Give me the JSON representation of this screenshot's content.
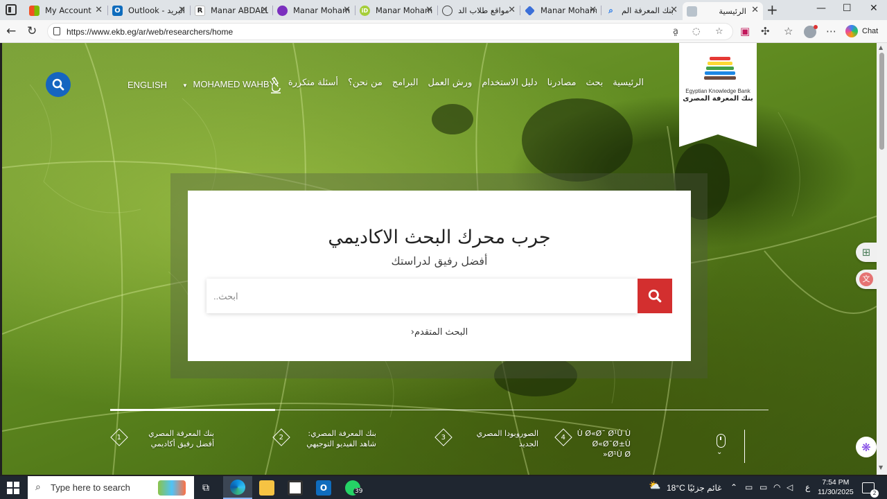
{
  "browser": {
    "tabs": [
      {
        "title": "My Account",
        "icon": "microsoft-icon",
        "color": "#f25022"
      },
      {
        "title": "Outlook - البريد",
        "icon": "outlook-icon",
        "color": "#0f6cbd"
      },
      {
        "title": "Manar ABDALL",
        "icon": "researchgate-icon",
        "color": "#444444"
      },
      {
        "title": "Manar Moham",
        "icon": "mendeley-icon",
        "color": "#7b2fbe"
      },
      {
        "title": "Manar Moham",
        "icon": "orcid-icon",
        "color": "#a6ce39"
      },
      {
        "title": "مواقع طلاب الد",
        "icon": "globe-icon",
        "color": "#555555"
      },
      {
        "title": "Manar Moham",
        "icon": "diamond-icon",
        "color": "#3b6fd8"
      },
      {
        "title": "بنك المعرفة الم",
        "icon": "search-icon",
        "color": "#1a73e8"
      },
      {
        "title": "الرئيسية",
        "icon": "ekb-icon",
        "color": "#6d7b88"
      }
    ],
    "url": "https://www.ekb.eg/ar/web/researchers/home",
    "chat_label": "Chat"
  },
  "site": {
    "logo_en": "Egyptian Knowledge Bank",
    "logo_ar": "بنك المعرفة المصرى",
    "nav": [
      "الرئيسية",
      "بحث",
      "مصادرنا",
      "دليل الاستخدام",
      "ورش العمل",
      "البرامج",
      "من نحن؟",
      "أسئلة متكررة"
    ],
    "user_name": "MOHAMED WAHBY",
    "language": "ENGLISH",
    "hero_title": "جرب محرك البحث الاكاديمي",
    "hero_subtitle": "أفضل رفيق لدراستك",
    "search_placeholder": "ابحث..",
    "advanced_search": "البحث المتقدم",
    "advanced_search_arrow": "‹",
    "slides": [
      {
        "num": "1",
        "text": "بنك المعرفة المصري أفضل رفيق أكاديمي"
      },
      {
        "num": "2",
        "text": "بنك المعرفة المصري: شاهد الفيديو التوجيهي"
      },
      {
        "num": "3",
        "text": "الصوروبودا المصري الجديد"
      },
      {
        "num": "4",
        "text": "Ù Ø«Ø¯ Ø¹Ù Ù Ø«Ø¯Ø±Ù Ø¹Ù Ø«"
      }
    ],
    "slider_progress": 0.25
  },
  "taskbar": {
    "search_placeholder": "Type here to search",
    "whatsapp_badge": "39",
    "weather": "18°C  غائم جزئيًا",
    "lang_indicator": "ع",
    "time": "7:54 PM",
    "date": "11/30/2025",
    "notifications": "2"
  }
}
